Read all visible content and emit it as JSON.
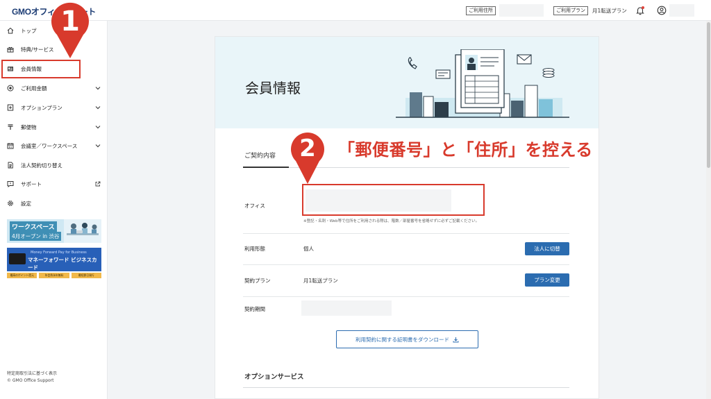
{
  "header": {
    "logo": "GMOオフィスサポート",
    "address_tag": "ご利用住所",
    "plan_tag": "ご利用プラン",
    "plan_value": "月1転送プラン",
    "icons": [
      "bell-icon",
      "user-circle-icon"
    ],
    "notification_dot_color": "#e0433a"
  },
  "sidebar": {
    "items": [
      {
        "label": "トップ",
        "icon": "home-icon"
      },
      {
        "label": "特典/サービス",
        "icon": "gift-icon"
      },
      {
        "label": "会員情報",
        "icon": "id-card-icon"
      },
      {
        "label": "ご利用金額",
        "icon": "coin-icon"
      },
      {
        "label": "オプションプラン",
        "icon": "plus-doc-icon"
      },
      {
        "label": "郵便物",
        "icon": "postal-icon"
      },
      {
        "label": "会議室／ワークスペース",
        "icon": "calendar-icon"
      },
      {
        "label": "法人契約切り替え",
        "icon": "document-icon"
      },
      {
        "label": "サポート",
        "icon": "support-icon"
      },
      {
        "label": "設定",
        "icon": "gear-icon"
      }
    ],
    "banner_workspace": {
      "title": "ワークスペース",
      "subtitle": "4月オープン in 渋谷"
    },
    "banner_card": {
      "small": "Money Forward Pay for Business",
      "title": "マネーフォワード ビジネスカード",
      "badges": [
        "最高のポイント還元",
        "年会費永年無料",
        "最短即日発行"
      ]
    },
    "footer_notice": "特定商取引法に基づく表示",
    "footer_copy": "© GMO Office Support"
  },
  "markers": {
    "first": "1",
    "second": "2"
  },
  "instruction": "「郵便番号」と「住所」を控える",
  "main": {
    "title": "会員情報",
    "tab": "ご契約内容",
    "rows": {
      "office_label": "オフィス",
      "office_note": "※登記・名刺・Web等で住所をご利用される際は、階数／部屋番号を省略せずに必ずご記載ください。",
      "usage_label": "利用形態",
      "usage_value": "個人",
      "usage_button": "法人に切替",
      "plan_label": "契約プラン",
      "plan_value": "月1転送プラン",
      "plan_button": "プラン変更",
      "period_label": "契約期間"
    },
    "download_button": "利用契約に関する証明書をダウンロード",
    "option_title": "オプションサービス"
  },
  "colors": {
    "accent_red": "#d83a2c",
    "button_blue": "#2b6cb0",
    "brand_navy": "#1c3c74",
    "hero_bg": "#e9f5f9"
  }
}
